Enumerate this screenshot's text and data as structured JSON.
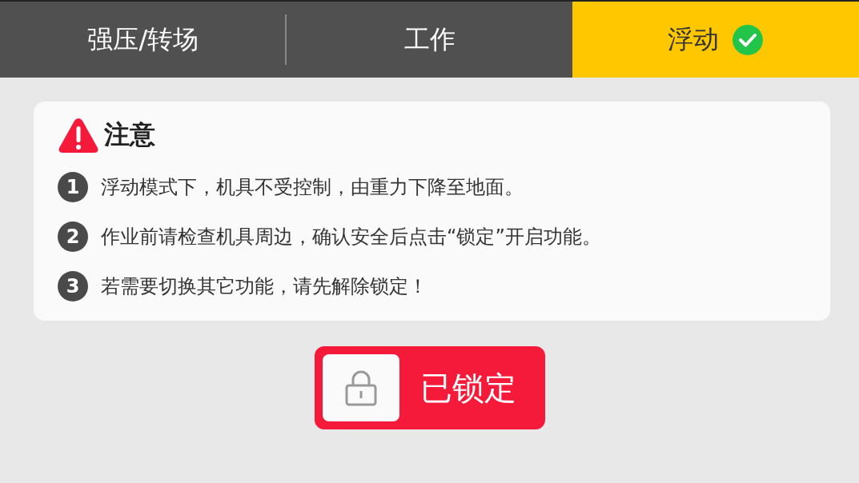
{
  "tabs": [
    {
      "label": "强压/转场",
      "selected": false
    },
    {
      "label": "工作",
      "selected": false
    },
    {
      "label": "浮动",
      "selected": true
    }
  ],
  "notice": {
    "title": "注意",
    "items": [
      {
        "number": "1",
        "text": "浮动模式下，机具不受控制，由重力下降至地面。"
      },
      {
        "number": "2",
        "text": "作业前请检查机具周边，确认安全后点击“锁定”开启功能。"
      },
      {
        "number": "3",
        "text": "若需要切换其它功能，请先解除锁定！"
      }
    ]
  },
  "lock_button": {
    "label": "已锁定",
    "locked": true
  }
}
